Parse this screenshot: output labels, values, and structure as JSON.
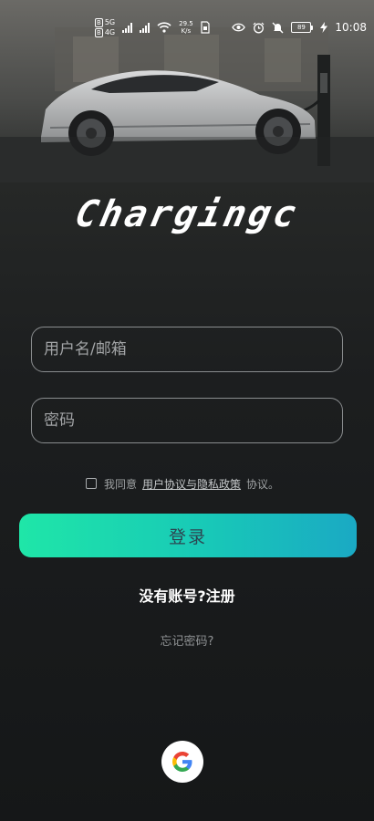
{
  "status_bar": {
    "sim1": "B",
    "sim1_tag": "5G",
    "sim2": "B",
    "sim2_tag": "4G",
    "net_speed_value": "29.5",
    "net_speed_unit": "K/s",
    "battery": "89",
    "time": "10:08"
  },
  "icons": {
    "eye": "eye-icon",
    "alarm": "alarm-icon",
    "mute": "mute-icon",
    "charging": "charging-bolt-icon",
    "google": "google-icon"
  },
  "app": {
    "logo": "Chargingc"
  },
  "form": {
    "username_placeholder": "用户名/邮箱",
    "password_placeholder": "密码",
    "agree_prefix": "我同意",
    "agree_link": "用户协议与隐私政策",
    "agree_suffix": "协议。",
    "agree_checked": false,
    "login_label": "登录",
    "register_label": "没有账号?注册",
    "forgot_label": "忘记密码?"
  },
  "colors": {
    "accent_start": "#1fe6a8",
    "accent_end": "#1aa9c4",
    "background": "#151718"
  }
}
